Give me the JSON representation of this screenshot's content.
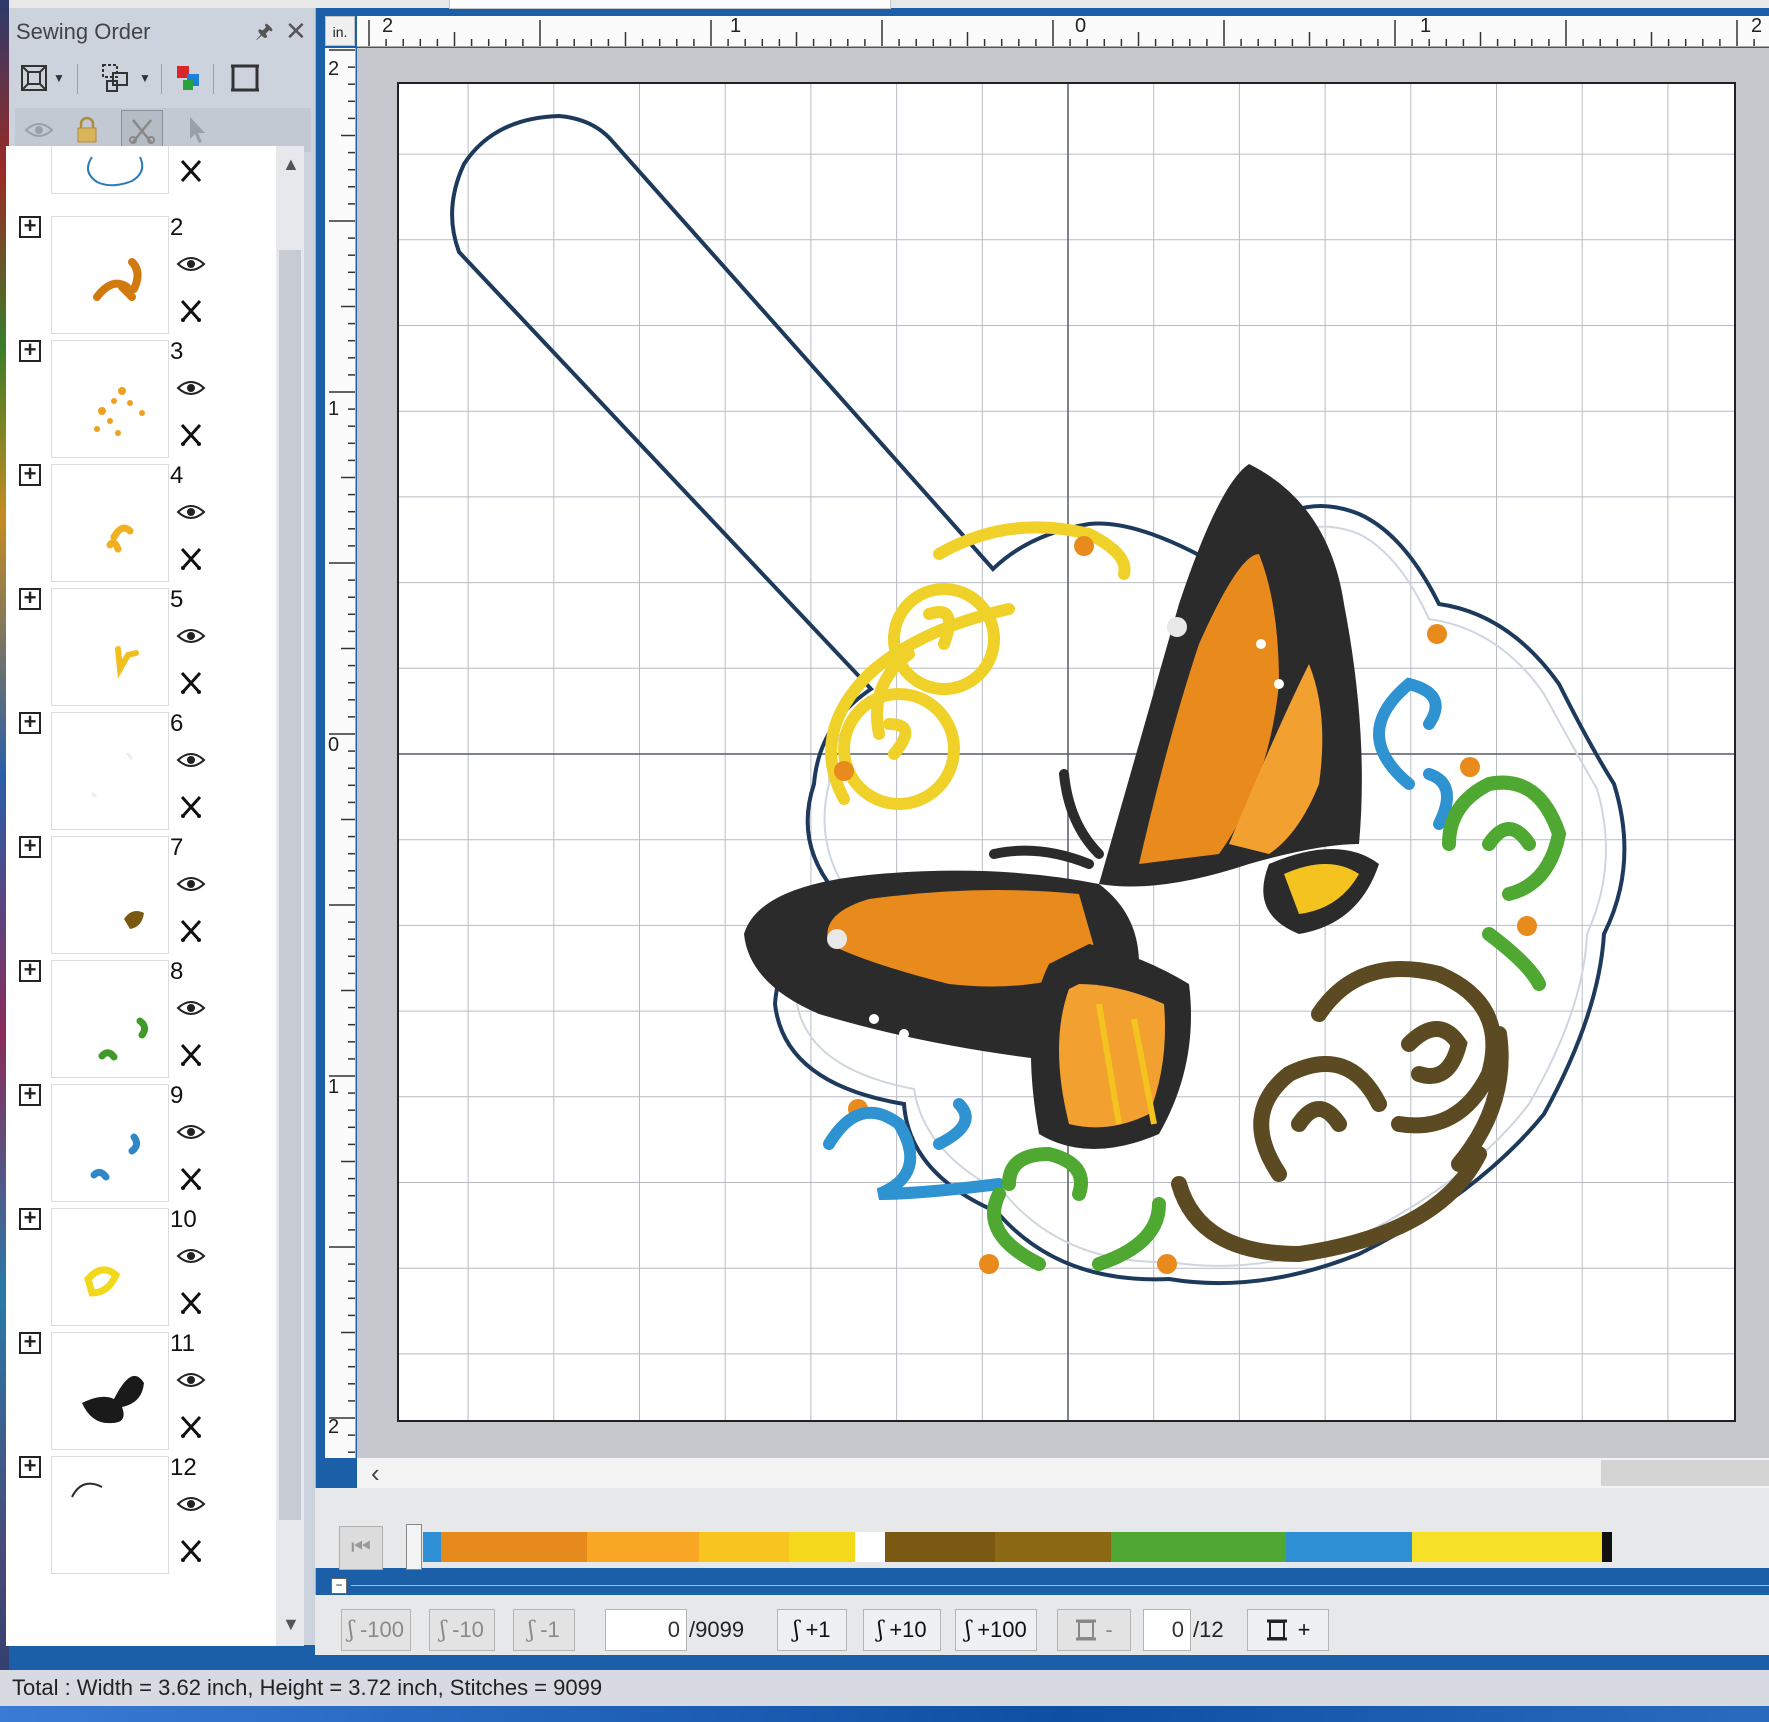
{
  "panel": {
    "title": "Sewing Order",
    "items": [
      {
        "num": "2"
      },
      {
        "num": "3"
      },
      {
        "num": "4"
      },
      {
        "num": "5"
      },
      {
        "num": "6"
      },
      {
        "num": "7"
      },
      {
        "num": "8"
      },
      {
        "num": "9"
      },
      {
        "num": "10"
      },
      {
        "num": "11"
      },
      {
        "num": "12"
      }
    ]
  },
  "ruler": {
    "unit": "in.",
    "top_labels": [
      "2",
      "1",
      "0",
      "1",
      "2"
    ],
    "left_labels": [
      "2",
      "1",
      "0",
      "1",
      "2"
    ]
  },
  "colors": {
    "segments": [
      "#2e8fd4",
      "#e58a1b",
      "#f7a723",
      "#f8c51e",
      "#f3d81b",
      "#ffffff",
      "#7a5a12",
      "#8b6914",
      "#4ea832",
      "#2e8fd4",
      "#f7e028",
      "#111111"
    ]
  },
  "navigator": {
    "minus100": "-100",
    "minus10": "-10",
    "minus1": "-1",
    "stitch_value": "0",
    "stitch_total": "/9099",
    "plus1": "+1",
    "plus10": "+10",
    "plus100": "+100",
    "color_minus": "-",
    "color_value": "0",
    "color_total": "/12",
    "color_plus": "+"
  },
  "status": {
    "text": "Total : Width = 3.62 inch, Height = 3.72 inch, Stitches = 9099"
  }
}
